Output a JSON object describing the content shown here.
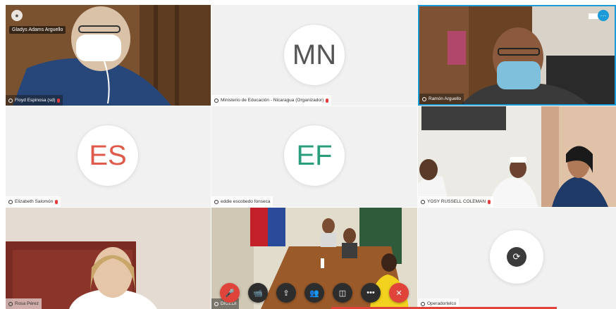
{
  "tiles": {
    "t1": {
      "overlay_label": "Gladys Adams Arguello",
      "name": "Floyd Espinosa (sd)"
    },
    "t2": {
      "initials": "MN",
      "initials_color": "#555555",
      "name": "Ministerio de Educación - Nicaragua (Organizador)"
    },
    "t3": {
      "name": "Ramón Arguello"
    },
    "t4": {
      "initials": "ES",
      "initials_color": "#e05a4b",
      "name": "Elizabeth Salomón"
    },
    "t5": {
      "initials": "EF",
      "initials_color": "#2a9d7c",
      "name": "eddie escobedo fonseca"
    },
    "t6": {
      "name": "YOSY RUSSELL COLEMAN"
    },
    "t7": {
      "name": "Rosa Pérez"
    },
    "t8": {
      "name": "DIGEDI"
    },
    "t9": {
      "name": "Operadortelco"
    }
  },
  "controls": {
    "mic": "🎤",
    "video": "📹",
    "share": "⇪",
    "participants": "👥",
    "layout": "◫",
    "more": "•••",
    "hangup": "✕"
  },
  "colors": {
    "accent": "#1a9bd7",
    "hangup": "#e0433a"
  }
}
